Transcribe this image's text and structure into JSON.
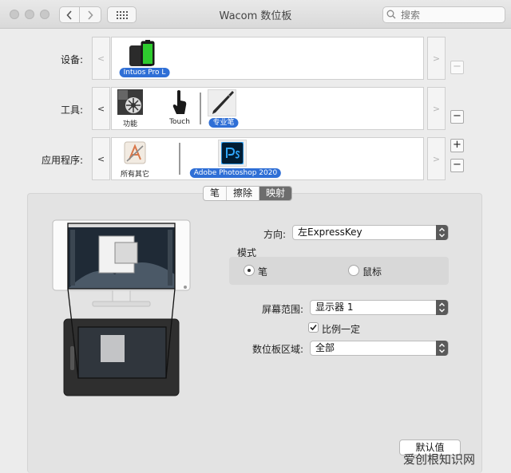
{
  "window": {
    "title": "Wacom 数位板"
  },
  "search": {
    "placeholder": "搜索"
  },
  "devices": {
    "label": "设备:",
    "items": [
      {
        "label": "Intuos Pro L",
        "selected": true
      }
    ]
  },
  "tools": {
    "label": "工具:",
    "items": [
      {
        "label": "功能",
        "selected": false
      },
      {
        "label": "Touch",
        "selected": false
      },
      {
        "label": "专业笔",
        "selected": true
      }
    ]
  },
  "apps": {
    "label": "应用程序:",
    "items": [
      {
        "label": "所有其它",
        "selected": false
      },
      {
        "label": "Adobe Photoshop 2020",
        "selected": true
      }
    ]
  },
  "tabs": [
    {
      "label": "笔",
      "active": false
    },
    {
      "label": "擦除",
      "active": false
    },
    {
      "label": "映射",
      "active": true
    }
  ],
  "mapping": {
    "orientation_label": "方向:",
    "orientation_value": "左ExpressKey",
    "mode_label": "模式",
    "mode_pen": "笔",
    "mode_mouse": "鼠标",
    "mode_selected": "pen",
    "screen_label": "屏幕范围:",
    "screen_value": "显示器 1",
    "proportional_label": "比例一定",
    "proportional_checked": true,
    "tablet_label": "数位板区域:",
    "tablet_value": "全部",
    "default_button": "默认值"
  },
  "watermark": "爱创根知识网",
  "colors": {
    "accent": "#2f6fd6",
    "selected_tab": "#6d6d6d",
    "popup_arrows": "#5a5a5a"
  }
}
